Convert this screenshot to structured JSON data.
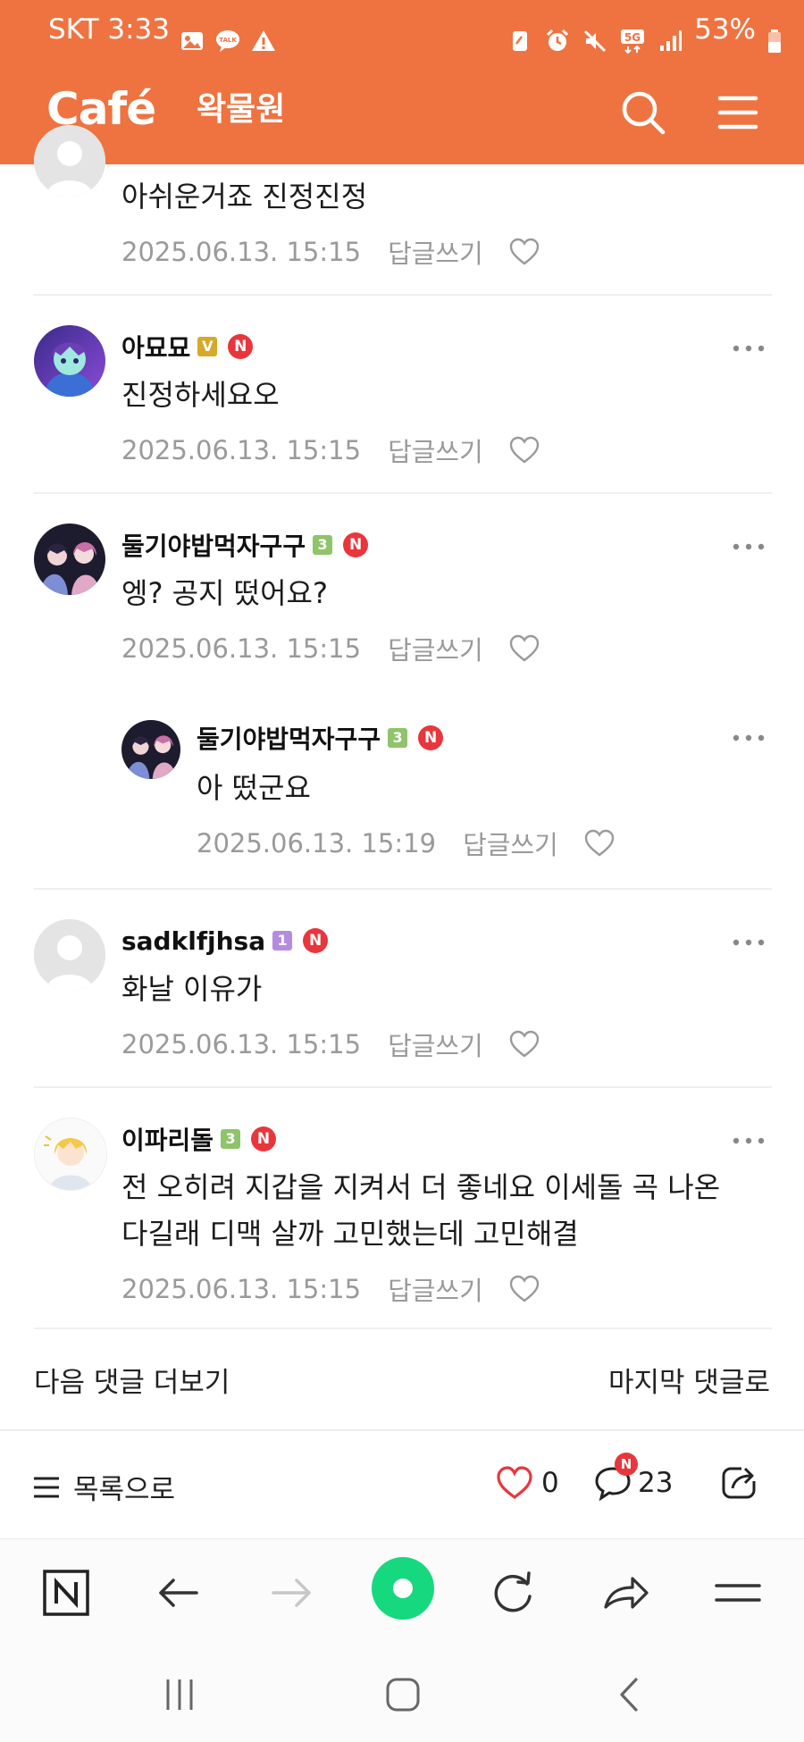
{
  "status_bar": {
    "carrier_time": "SKT 3:33",
    "battery": "53%",
    "left_icons": [
      "image-icon",
      "talk-icon",
      "warning-icon"
    ],
    "right_icons": [
      "note-icon",
      "alarm-icon",
      "mute-icon",
      "5g-icon",
      "signal-icon",
      "battery-icon"
    ]
  },
  "header": {
    "logo": "Café",
    "cafe_name": "왁물원"
  },
  "comments": [
    {
      "id": "c0",
      "nickname": "",
      "text": "아쉬운거죠 진정진정",
      "date": "2025.06.13. 15:15",
      "reply_label": "답글쓰기",
      "avatar": "default"
    },
    {
      "id": "c1",
      "nickname": "아묘묘",
      "level_badge": "V",
      "n_badge": "N",
      "text": "진정하세요오",
      "date": "2025.06.13. 15:15",
      "reply_label": "답글쓰기",
      "avatar": "anime-blue"
    },
    {
      "id": "c2",
      "nickname": "둘기야밥먹자구구",
      "level_badge": "3",
      "n_badge": "N",
      "text": "엥? 공지 떴어요?",
      "date": "2025.06.13. 15:15",
      "reply_label": "답글쓰기",
      "avatar": "anime-dark"
    },
    {
      "id": "c3",
      "nickname": "둘기야밥먹자구구",
      "level_badge": "3",
      "n_badge": "N",
      "text": "아 떴군요",
      "date": "2025.06.13. 15:19",
      "reply_label": "답글쓰기",
      "avatar": "anime-dark",
      "is_reply": true
    },
    {
      "id": "c4",
      "nickname": "sadklfjhsa",
      "level_badge": "1",
      "n_badge": "N",
      "text": "화날 이유가",
      "date": "2025.06.13. 15:15",
      "reply_label": "답글쓰기",
      "avatar": "default"
    },
    {
      "id": "c5",
      "nickname": "이파리돌",
      "level_badge": "3",
      "n_badge": "N",
      "text_line1": "전 오히려 지갑을 지켜서 더 좋네요 이세돌 곡 나온",
      "text_line2": "다길래 디맥 살까 고민했는데 고민해결",
      "date": "2025.06.13. 15:15",
      "reply_label": "답글쓰기",
      "avatar": "anime-blonde"
    }
  ],
  "pager": {
    "more_label": "다음 댓글 더보기",
    "last_label": "마지막 댓글로"
  },
  "action_bar": {
    "list_label": "목록으로",
    "like_count": "0",
    "comment_count": "23",
    "comment_badge": "N"
  },
  "browser_nav": {
    "buttons": [
      "naver-home-icon",
      "back-icon",
      "forward-icon",
      "green-dot-icon",
      "refresh-icon",
      "share-icon",
      "menu-icon"
    ]
  },
  "colors": {
    "brand_orange": "#ee7340",
    "badge_red": "#e8363c",
    "level_green": "#8fc46b",
    "level_purple": "#b58be0",
    "level_gold": "#d7a92b",
    "meta_gray": "#9a9a9a",
    "naver_green": "#16d97f"
  }
}
